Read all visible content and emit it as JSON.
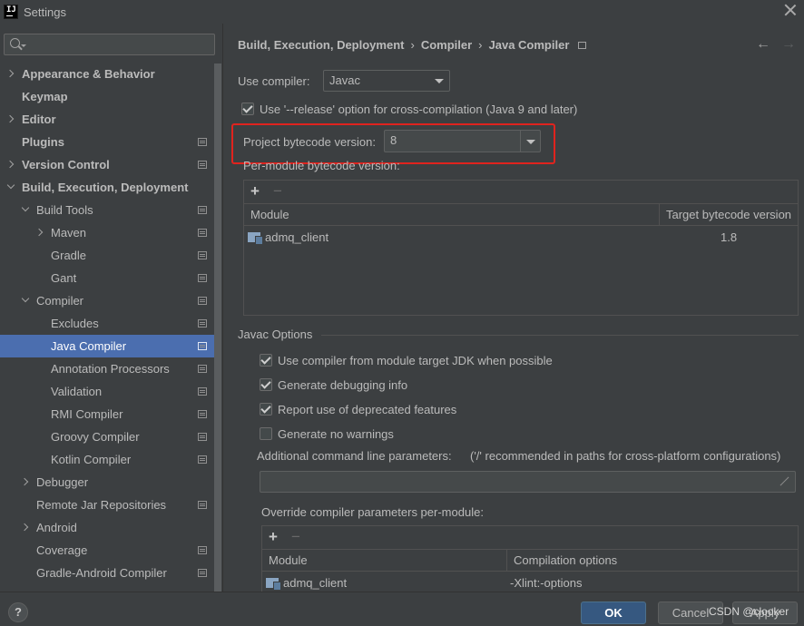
{
  "window": {
    "title": "Settings",
    "app_icon_text": "IJ"
  },
  "sidebar": {
    "search_placeholder": "",
    "items": [
      {
        "label": "Appearance & Behavior",
        "bold": true
      },
      {
        "label": "Keymap",
        "bold": true
      },
      {
        "label": "Editor",
        "bold": true
      },
      {
        "label": "Plugins",
        "bold": true
      },
      {
        "label": "Version Control",
        "bold": true
      },
      {
        "label": "Build, Execution, Deployment",
        "bold": true
      },
      {
        "label": "Build Tools"
      },
      {
        "label": "Maven"
      },
      {
        "label": "Gradle"
      },
      {
        "label": "Gant"
      },
      {
        "label": "Compiler"
      },
      {
        "label": "Excludes"
      },
      {
        "label": "Java Compiler",
        "selected": true
      },
      {
        "label": "Annotation Processors"
      },
      {
        "label": "Validation"
      },
      {
        "label": "RMI Compiler"
      },
      {
        "label": "Groovy Compiler"
      },
      {
        "label": "Kotlin Compiler"
      },
      {
        "label": "Debugger"
      },
      {
        "label": "Remote Jar Repositories"
      },
      {
        "label": "Android"
      },
      {
        "label": "Coverage"
      },
      {
        "label": "Gradle-Android Compiler"
      }
    ]
  },
  "breadcrumb": [
    "Build, Execution, Deployment",
    "Compiler",
    "Java Compiler"
  ],
  "breadcrumb_sep": "›",
  "nav": {
    "back": "←",
    "forward": "→"
  },
  "compiler": {
    "use_compiler_label": "Use compiler:",
    "use_compiler_value": "Javac",
    "release_option_label": "Use '--release' option for cross-compilation (Java 9 and later)",
    "release_option_checked": true,
    "bytecode_label": "Project bytecode version:",
    "bytecode_value": "8",
    "per_module_label": "Per-module bytecode version:",
    "per_module_table": {
      "add": "+",
      "remove": "−",
      "columns": [
        "Module",
        "Target bytecode version"
      ],
      "rows": [
        {
          "module": "admq_client",
          "version": "1.8"
        }
      ]
    }
  },
  "javac": {
    "section_title": "Javac Options",
    "options": [
      {
        "label": "Use compiler from module target JDK when possible",
        "checked": true
      },
      {
        "label": "Generate debugging info",
        "checked": true
      },
      {
        "label": "Report use of deprecated features",
        "checked": true
      },
      {
        "label": "Generate no warnings",
        "checked": false
      }
    ],
    "additional_params_label": "Additional command line parameters:",
    "additional_params_hint": "('/' recommended in paths for cross-platform configurations)",
    "additional_params_value": "",
    "override_label": "Override compiler parameters per-module:",
    "override_table": {
      "add": "+",
      "remove": "−",
      "columns": [
        "Module",
        "Compilation options"
      ],
      "rows": [
        {
          "module": "admq_client",
          "options": "-Xlint:-options"
        }
      ]
    }
  },
  "footer": {
    "help": "?",
    "ok": "OK",
    "cancel": "Cancel",
    "apply": "Apply",
    "watermark": "CSDN @clooker"
  },
  "colors": {
    "accent": "#4b6eaf",
    "highlight_box": "#e0231e",
    "ok_button": "#365880"
  }
}
